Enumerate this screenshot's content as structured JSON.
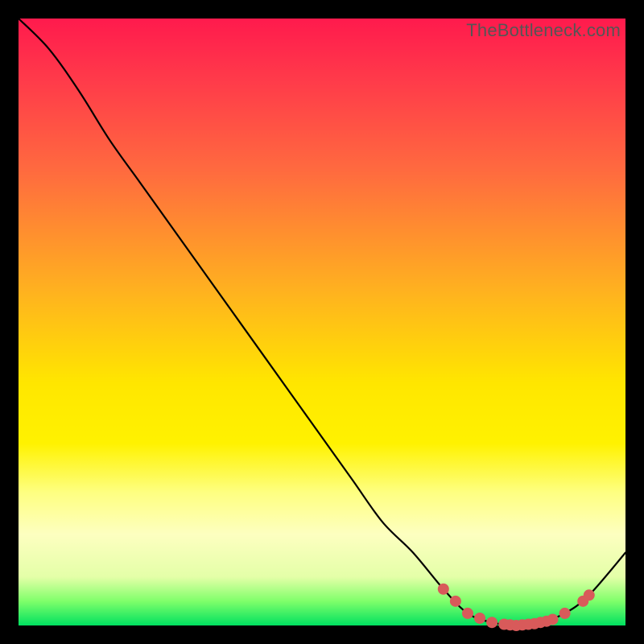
{
  "watermark": "TheBottleneck.com",
  "chart_data": {
    "type": "line",
    "title": "",
    "xlabel": "",
    "ylabel": "",
    "xlim": [
      0,
      100
    ],
    "ylim": [
      0,
      100
    ],
    "note": "Bottleneck curve on a gradient background; y=0 (green) is optimal, y=100 (red) is fully bottlenecked. Minimum around x≈82.",
    "series": [
      {
        "name": "bottleneck-curve",
        "x": [
          0,
          5,
          10,
          15,
          20,
          25,
          30,
          35,
          40,
          45,
          50,
          55,
          60,
          65,
          70,
          74,
          78,
          82,
          86,
          90,
          94,
          100
        ],
        "y": [
          100,
          95,
          88,
          80,
          73,
          66,
          59,
          52,
          45,
          38,
          31,
          24,
          17,
          12,
          6,
          2,
          0.5,
          0,
          0.5,
          2,
          5,
          12
        ]
      }
    ],
    "highlight_points": {
      "name": "near-optimal-region",
      "x": [
        70,
        72,
        74,
        76,
        78,
        80,
        81,
        82,
        83,
        84,
        85,
        86,
        87,
        88,
        90,
        93,
        94
      ],
      "y": [
        6,
        4,
        2,
        1.2,
        0.5,
        0.2,
        0.1,
        0,
        0.1,
        0.2,
        0.3,
        0.5,
        0.7,
        1,
        2,
        4,
        5
      ]
    },
    "gradient_stops": [
      {
        "pos": 0.0,
        "color": "#ff1a4d"
      },
      {
        "pos": 0.45,
        "color": "#ffb21f"
      },
      {
        "pos": 0.7,
        "color": "#fff200"
      },
      {
        "pos": 1.0,
        "color": "#00e060"
      }
    ]
  }
}
